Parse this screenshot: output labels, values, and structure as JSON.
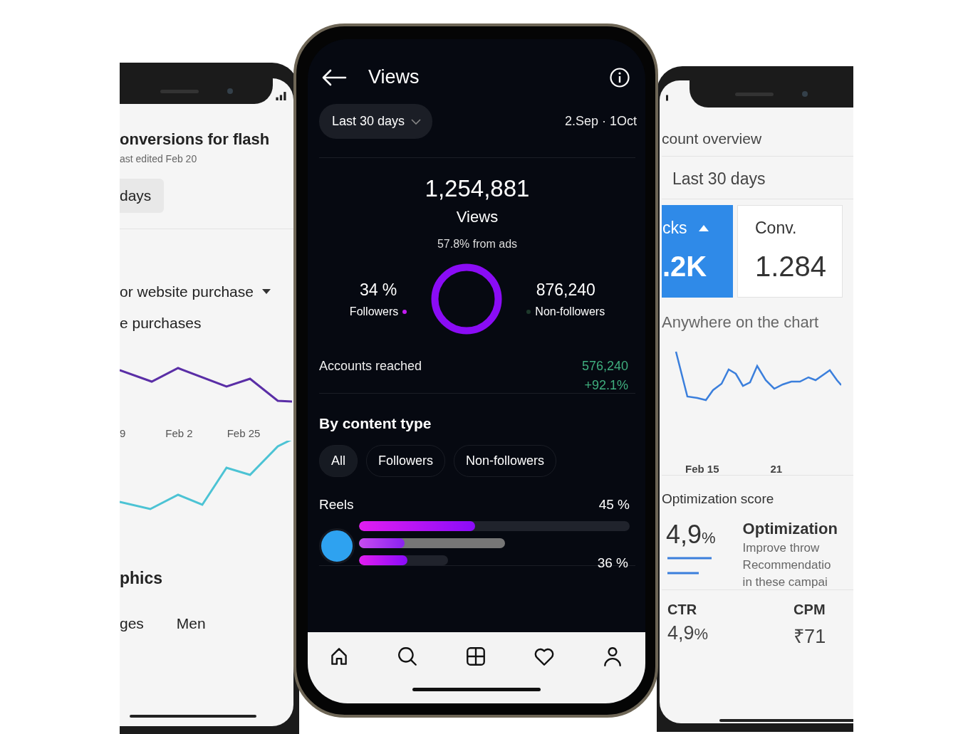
{
  "left_phone": {
    "title": "onversions for flash",
    "subtitle": "ast edited Feb 20",
    "range": "days",
    "metric_dropdown": "or website purchase",
    "metric": "e purchases",
    "x_labels": [
      "9",
      "Feb 2",
      "Feb 25"
    ],
    "section_title": "phics",
    "filters": [
      "ges",
      "Men"
    ]
  },
  "center_phone": {
    "title": "Views",
    "range_button": "Last 30 days",
    "date_range": "2.Sep · 1Oct",
    "total": "1,254,881",
    "total_label": "Views",
    "ads_note": "57.8% from ads",
    "followers": {
      "value": "34 %",
      "label": "Followers",
      "color": "#c21cf0"
    },
    "non_followers": {
      "value": "876,240",
      "label": "Non-followers",
      "color": "#1e3a2c"
    },
    "accounts_reached": {
      "label": "Accounts reached",
      "value": "576,240",
      "change": "+92.1%"
    },
    "content_type": {
      "title": "By content type",
      "filters": [
        {
          "label": "All",
          "selected": true
        },
        {
          "label": "Followers",
          "selected": false
        },
        {
          "label": "Non-followers",
          "selected": false
        }
      ],
      "reels": {
        "label": "Reels",
        "top_value": "45 %",
        "bottom_value": "36 %",
        "bars": [
          {
            "level": 0.43
          },
          {
            "level": 0.31
          },
          {
            "level": 0.54
          }
        ]
      }
    },
    "nav": [
      {
        "kind": "home"
      },
      {
        "kind": "search"
      },
      {
        "kind": "grid"
      },
      {
        "kind": "heart"
      },
      {
        "kind": "profile"
      }
    ]
  },
  "right_phone": {
    "title": "count overview",
    "range": "Last 30 days",
    "metrics": [
      {
        "label": "cks",
        "value": ".2K",
        "selected": true
      },
      {
        "label": "Conv.",
        "value": "1.284",
        "selected": false
      }
    ],
    "chart_hint": "Anywhere on the chart",
    "x_labels": [
      "Feb 15",
      "21"
    ],
    "score_title": "Optimization score",
    "score_value": "4,9",
    "score_unit": "%",
    "tip_title": "Optimization",
    "tip_lines": [
      "Improve throw",
      "Recommendatio",
      "in these campai"
    ],
    "stats": [
      {
        "label": "CTR",
        "value": "4,9",
        "unit": "%"
      },
      {
        "label": "CPM",
        "value": "₹71"
      }
    ]
  }
}
